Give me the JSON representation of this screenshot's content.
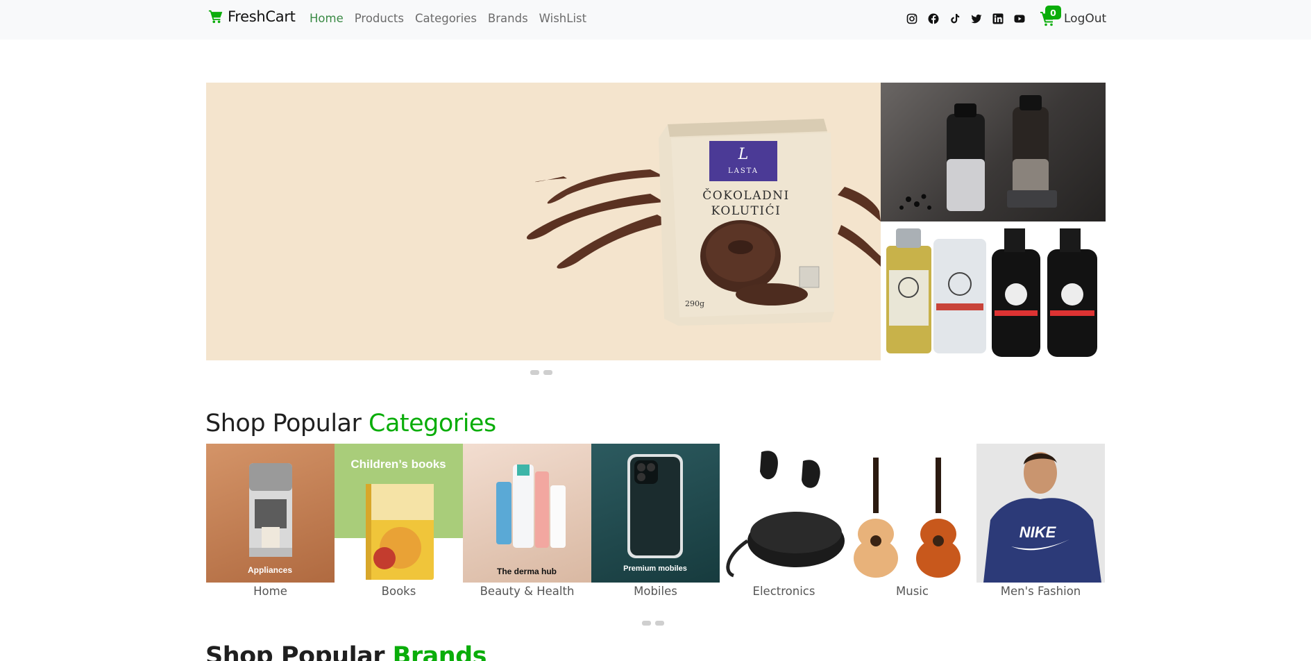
{
  "brand": {
    "name": "FreshCart",
    "icon": "cart-icon"
  },
  "nav": {
    "links": [
      {
        "label": "Home",
        "active": true
      },
      {
        "label": "Products",
        "active": false
      },
      {
        "label": "Categories",
        "active": false
      },
      {
        "label": "Brands",
        "active": false
      },
      {
        "label": "WishList",
        "active": false
      }
    ],
    "socials": [
      "instagram-icon",
      "facebook-icon",
      "tiktok-icon",
      "twitter-icon",
      "linkedin-icon",
      "youtube-icon"
    ],
    "cart_count": "0",
    "logout_label": "LogOut"
  },
  "hero": {
    "main_product": {
      "brand": "LASTA",
      "title_line1": "ČOKOLADNI",
      "title_line2": "KOLUTIĆI",
      "weight": "290g"
    },
    "slide_count": 2
  },
  "categories_section": {
    "title_prefix": "Shop Popular",
    "title_accent": "Categories",
    "items": [
      {
        "name": "Home",
        "overlay": "Appliances"
      },
      {
        "name": "Books",
        "overlay": "Children’s books"
      },
      {
        "name": "Beauty & Health",
        "overlay": "The derma hub"
      },
      {
        "name": "Mobiles",
        "overlay": "Premium mobiles"
      },
      {
        "name": "Electronics",
        "overlay": ""
      },
      {
        "name": "Music",
        "overlay": ""
      },
      {
        "name": "Men's Fashion",
        "overlay": "NIKE"
      }
    ]
  },
  "brands_section": {
    "title_prefix": "Shop Popular",
    "title_accent": "Brands"
  },
  "colors": {
    "accent": "#0aad0a",
    "nav_bg": "#f8f9fa",
    "active_link": "#3a8a45"
  }
}
